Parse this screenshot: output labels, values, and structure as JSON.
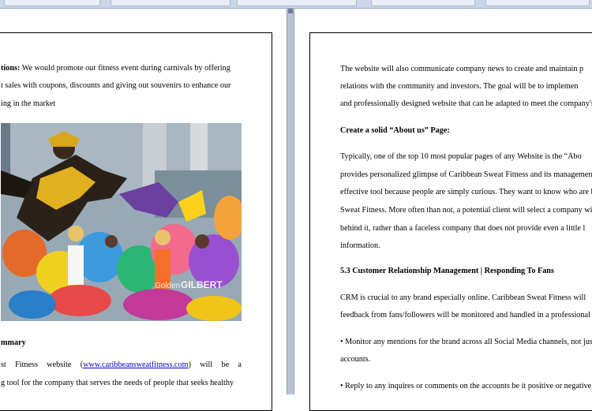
{
  "left_page": {
    "p1_line1_bold": "tions:",
    "p1_line1_rest": " We would promote our fitness event during carnivals by offering",
    "p1_line2": "t sales with coupons, discounts and giving out souvenirs to enhance our",
    "p1_line3": "ing in the market",
    "photo_watermark_1": "Golden",
    "photo_watermark_2": "GILBERT",
    "heading": "mmary",
    "p2_line1_a": "st",
    "p2_line1_b": "Fitness",
    "p2_line1_c": "website",
    "p2_line1_link": "www.caribbeansweatfitness.com",
    "p2_line1_d": "will",
    "p2_line1_e": "be",
    "p2_line1_f": "a",
    "p2_line2": "g tool for the company that serves the needs of people that seeks healthy"
  },
  "right_page": {
    "l1": "The website will also communicate company news to create and maintain p",
    "l2": "relations with the community and investors. The goal will be to implemen",
    "l3": "and professionally designed website that can be adapted to meet the company's g",
    "heading1": "Create a solid “About us” Page:",
    "l4": "Typically, one of the top 10 most popular pages of any Website is the “Abo",
    "l5": "provides personalized glimpse of Caribbean Sweat Fitness and its management te",
    "l6": "effective tool because people are simply curious. They want to know who are beh",
    "l7": "Sweat Fitness. More often than not, a potential client will select a company with",
    "l8": "behind it, rather than a faceless company that does not provide even a little l",
    "l9": "information.",
    "heading2": "5.3 Customer Relationship Management | Responding To Fans",
    "l10": "CRM is crucial to any brand especially online. Caribbean Sweat Fitness will",
    "l11": "feedback from fans/followers will be monitored and handled in a professional yet",
    "l12": "• Monitor any mentions for the brand across all Social Media channels, not just",
    "l13": "accounts.",
    "l14": "• Reply to any inquires or comments on the accounts be it positive or negative."
  }
}
